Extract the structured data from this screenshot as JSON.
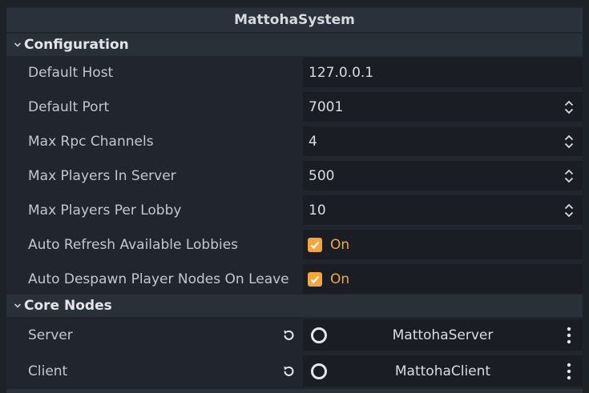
{
  "panel": {
    "title": "MattohaSystem"
  },
  "sections": {
    "configuration": {
      "label": "Configuration"
    },
    "core_nodes": {
      "label": "Core Nodes"
    }
  },
  "properties": {
    "default_host": {
      "label": "Default Host",
      "value": "127.0.0.1"
    },
    "default_port": {
      "label": "Default Port",
      "value": "7001"
    },
    "max_rpc_channels": {
      "label": "Max Rpc Channels",
      "value": "4"
    },
    "max_players_in_server": {
      "label": "Max Players In Server",
      "value": "500"
    },
    "max_players_per_lobby": {
      "label": "Max Players Per Lobby",
      "value": "10"
    },
    "auto_refresh_available_lobbies": {
      "label": "Auto Refresh Available Lobbies",
      "checked": true,
      "state_text": "On"
    },
    "auto_despawn_player_nodes_on_leave": {
      "label": "Auto Despawn Player Nodes On Leave",
      "checked": true,
      "state_text": "On"
    }
  },
  "nodes": {
    "server": {
      "label": "Server",
      "value": "MattohaServer"
    },
    "client": {
      "label": "Client",
      "value": "MattohaClient"
    }
  },
  "colors": {
    "accent": "#f6a53a",
    "background": "#21262e",
    "field_background": "#1a1e24"
  },
  "icons": {
    "section_toggle": "chevron-down-icon",
    "spinner": "up-down-arrows-icon",
    "checkbox": "checkmark-icon",
    "revert": "revert-icon",
    "node": "node-circle-icon",
    "menu": "kebab-menu-icon"
  }
}
